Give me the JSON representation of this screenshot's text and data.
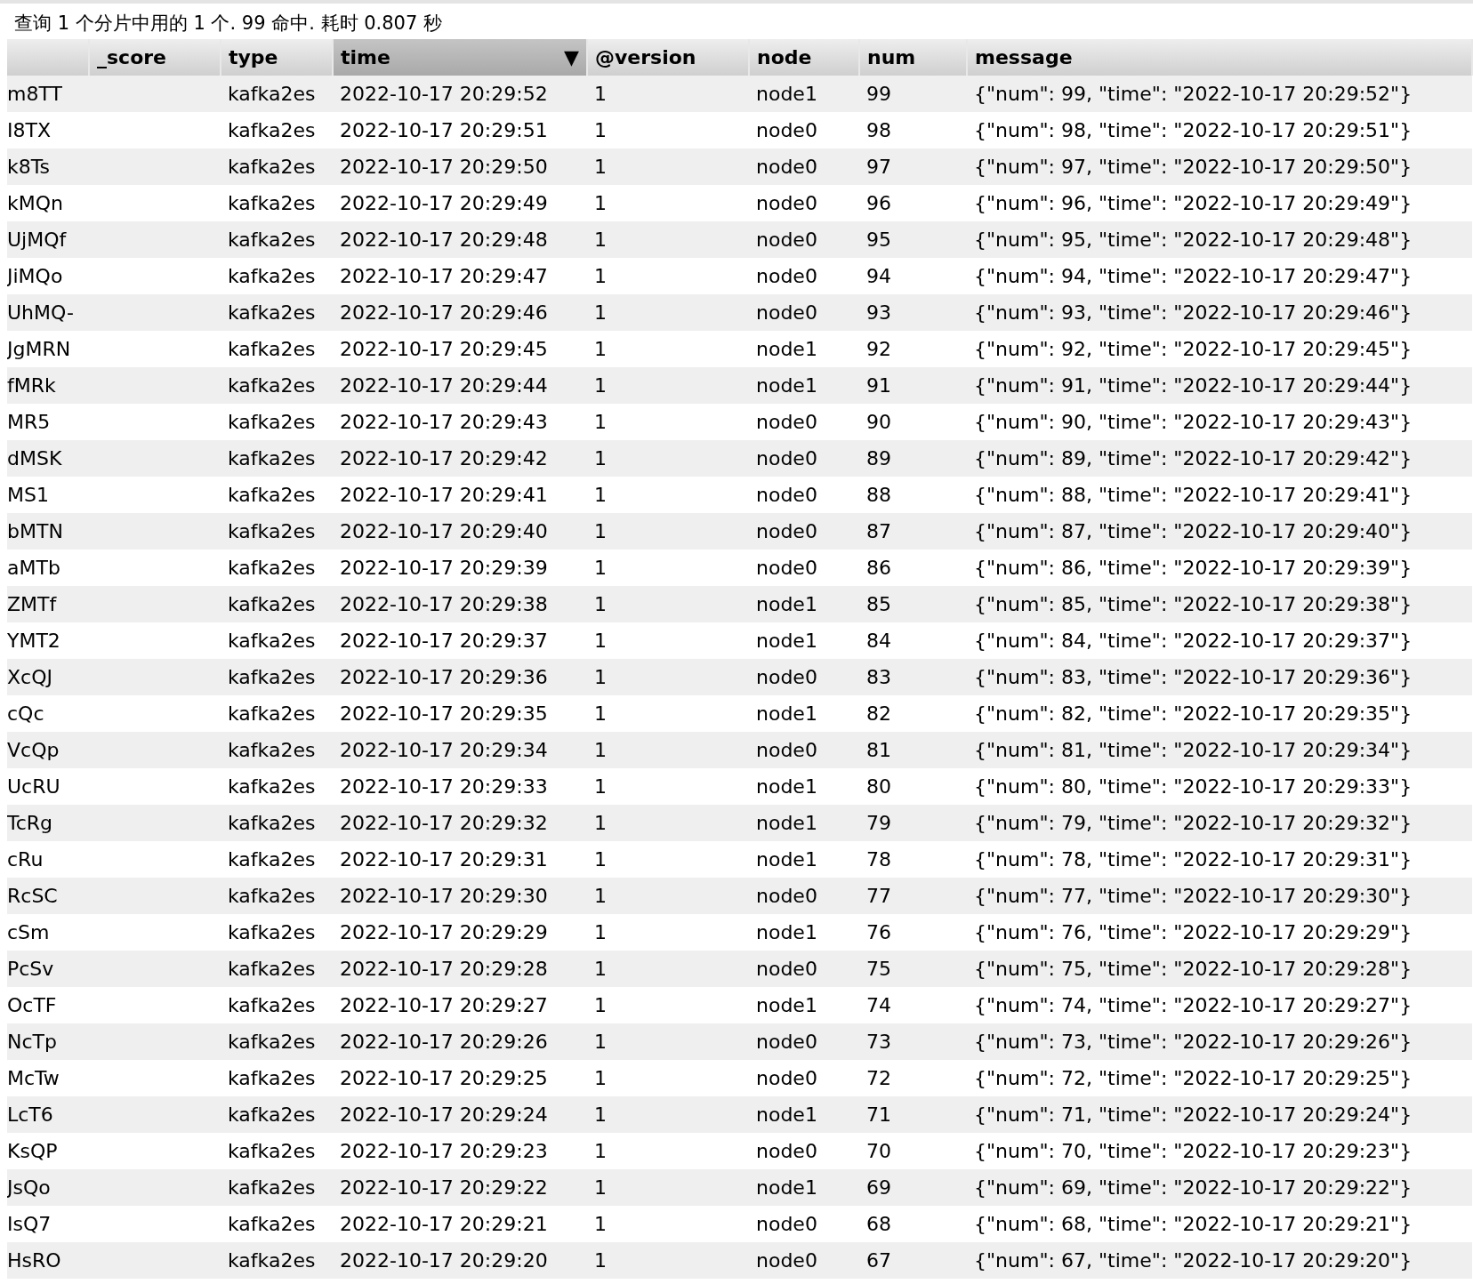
{
  "status": "查询 1 个分片中用的 1 个. 99 命中. 耗时 0.807 秒",
  "columns": [
    {
      "selected": false
    },
    {
      "label": "_score",
      "selected": false
    },
    {
      "label": "type",
      "selected": false
    },
    {
      "label": "time",
      "selected": true,
      "sort_indicator": "▼"
    },
    {
      "label": "@version",
      "selected": false
    },
    {
      "label": "node",
      "selected": false
    },
    {
      "label": "num",
      "selected": false
    },
    {
      "label": "message",
      "selected": false
    }
  ],
  "rows": [
    [
      "m8TT",
      null,
      "kafka2es",
      "2022-10-17 20:29:52",
      "1",
      "node1",
      "99",
      "{\"num\": 99, \"time\": \"2022-10-17 20:29:52\"}"
    ],
    [
      "I8TX",
      null,
      "kafka2es",
      "2022-10-17 20:29:51",
      "1",
      "node0",
      "98",
      "{\"num\": 98, \"time\": \"2022-10-17 20:29:51\"}"
    ],
    [
      "k8Ts",
      null,
      "kafka2es",
      "2022-10-17 20:29:50",
      "1",
      "node0",
      "97",
      "{\"num\": 97, \"time\": \"2022-10-17 20:29:50\"}"
    ],
    [
      "kMQn",
      null,
      "kafka2es",
      "2022-10-17 20:29:49",
      "1",
      "node0",
      "96",
      "{\"num\": 96, \"time\": \"2022-10-17 20:29:49\"}"
    ],
    [
      "UjMQf",
      null,
      "kafka2es",
      "2022-10-17 20:29:48",
      "1",
      "node0",
      "95",
      "{\"num\": 95, \"time\": \"2022-10-17 20:29:48\"}"
    ],
    [
      "JiMQo",
      null,
      "kafka2es",
      "2022-10-17 20:29:47",
      "1",
      "node0",
      "94",
      "{\"num\": 94, \"time\": \"2022-10-17 20:29:47\"}"
    ],
    [
      "UhMQ-",
      null,
      "kafka2es",
      "2022-10-17 20:29:46",
      "1",
      "node0",
      "93",
      "{\"num\": 93, \"time\": \"2022-10-17 20:29:46\"}"
    ],
    [
      "JgMRN",
      null,
      "kafka2es",
      "2022-10-17 20:29:45",
      "1",
      "node1",
      "92",
      "{\"num\": 92, \"time\": \"2022-10-17 20:29:45\"}"
    ],
    [
      "fMRk",
      null,
      "kafka2es",
      "2022-10-17 20:29:44",
      "1",
      "node1",
      "91",
      "{\"num\": 91, \"time\": \"2022-10-17 20:29:44\"}"
    ],
    [
      "MR5",
      null,
      "kafka2es",
      "2022-10-17 20:29:43",
      "1",
      "node0",
      "90",
      "{\"num\": 90, \"time\": \"2022-10-17 20:29:43\"}"
    ],
    [
      "dMSK",
      null,
      "kafka2es",
      "2022-10-17 20:29:42",
      "1",
      "node0",
      "89",
      "{\"num\": 89, \"time\": \"2022-10-17 20:29:42\"}"
    ],
    [
      "MS1",
      null,
      "kafka2es",
      "2022-10-17 20:29:41",
      "1",
      "node0",
      "88",
      "{\"num\": 88, \"time\": \"2022-10-17 20:29:41\"}"
    ],
    [
      "bMTN",
      null,
      "kafka2es",
      "2022-10-17 20:29:40",
      "1",
      "node0",
      "87",
      "{\"num\": 87, \"time\": \"2022-10-17 20:29:40\"}"
    ],
    [
      "aMTb",
      null,
      "kafka2es",
      "2022-10-17 20:29:39",
      "1",
      "node0",
      "86",
      "{\"num\": 86, \"time\": \"2022-10-17 20:29:39\"}"
    ],
    [
      "ZMTf",
      null,
      "kafka2es",
      "2022-10-17 20:29:38",
      "1",
      "node1",
      "85",
      "{\"num\": 85, \"time\": \"2022-10-17 20:29:38\"}"
    ],
    [
      "YMT2",
      null,
      "kafka2es",
      "2022-10-17 20:29:37",
      "1",
      "node1",
      "84",
      "{\"num\": 84, \"time\": \"2022-10-17 20:29:37\"}"
    ],
    [
      "XcQJ",
      null,
      "kafka2es",
      "2022-10-17 20:29:36",
      "1",
      "node0",
      "83",
      "{\"num\": 83, \"time\": \"2022-10-17 20:29:36\"}"
    ],
    [
      "cQc",
      null,
      "kafka2es",
      "2022-10-17 20:29:35",
      "1",
      "node1",
      "82",
      "{\"num\": 82, \"time\": \"2022-10-17 20:29:35\"}"
    ],
    [
      "VcQp",
      null,
      "kafka2es",
      "2022-10-17 20:29:34",
      "1",
      "node0",
      "81",
      "{\"num\": 81, \"time\": \"2022-10-17 20:29:34\"}"
    ],
    [
      "UcRU",
      null,
      "kafka2es",
      "2022-10-17 20:29:33",
      "1",
      "node1",
      "80",
      "{\"num\": 80, \"time\": \"2022-10-17 20:29:33\"}"
    ],
    [
      "TcRg",
      null,
      "kafka2es",
      "2022-10-17 20:29:32",
      "1",
      "node1",
      "79",
      "{\"num\": 79, \"time\": \"2022-10-17 20:29:32\"}"
    ],
    [
      "cRu",
      null,
      "kafka2es",
      "2022-10-17 20:29:31",
      "1",
      "node1",
      "78",
      "{\"num\": 78, \"time\": \"2022-10-17 20:29:31\"}"
    ],
    [
      "RcSC",
      null,
      "kafka2es",
      "2022-10-17 20:29:30",
      "1",
      "node0",
      "77",
      "{\"num\": 77, \"time\": \"2022-10-17 20:29:30\"}"
    ],
    [
      "cSm",
      null,
      "kafka2es",
      "2022-10-17 20:29:29",
      "1",
      "node1",
      "76",
      "{\"num\": 76, \"time\": \"2022-10-17 20:29:29\"}"
    ],
    [
      "PcSv",
      null,
      "kafka2es",
      "2022-10-17 20:29:28",
      "1",
      "node0",
      "75",
      "{\"num\": 75, \"time\": \"2022-10-17 20:29:28\"}"
    ],
    [
      "OcTF",
      null,
      "kafka2es",
      "2022-10-17 20:29:27",
      "1",
      "node1",
      "74",
      "{\"num\": 74, \"time\": \"2022-10-17 20:29:27\"}"
    ],
    [
      "NcTp",
      null,
      "kafka2es",
      "2022-10-17 20:29:26",
      "1",
      "node0",
      "73",
      "{\"num\": 73, \"time\": \"2022-10-17 20:29:26\"}"
    ],
    [
      "McTw",
      null,
      "kafka2es",
      "2022-10-17 20:29:25",
      "1",
      "node0",
      "72",
      "{\"num\": 72, \"time\": \"2022-10-17 20:29:25\"}"
    ],
    [
      "LcT6",
      null,
      "kafka2es",
      "2022-10-17 20:29:24",
      "1",
      "node1",
      "71",
      "{\"num\": 71, \"time\": \"2022-10-17 20:29:24\"}"
    ],
    [
      "KsQP",
      null,
      "kafka2es",
      "2022-10-17 20:29:23",
      "1",
      "node0",
      "70",
      "{\"num\": 70, \"time\": \"2022-10-17 20:29:23\"}"
    ],
    [
      "JsQo",
      null,
      "kafka2es",
      "2022-10-17 20:29:22",
      "1",
      "node1",
      "69",
      "{\"num\": 69, \"time\": \"2022-10-17 20:29:22\"}"
    ],
    [
      "IsQ7",
      null,
      "kafka2es",
      "2022-10-17 20:29:21",
      "1",
      "node0",
      "68",
      "{\"num\": 68, \"time\": \"2022-10-17 20:29:21\"}"
    ],
    [
      "HsRO",
      null,
      "kafka2es",
      "2022-10-17 20:29:20",
      "1",
      "node0",
      "67",
      "{\"num\": 67, \"time\": \"2022-10-17 20:29:20\"}"
    ]
  ]
}
